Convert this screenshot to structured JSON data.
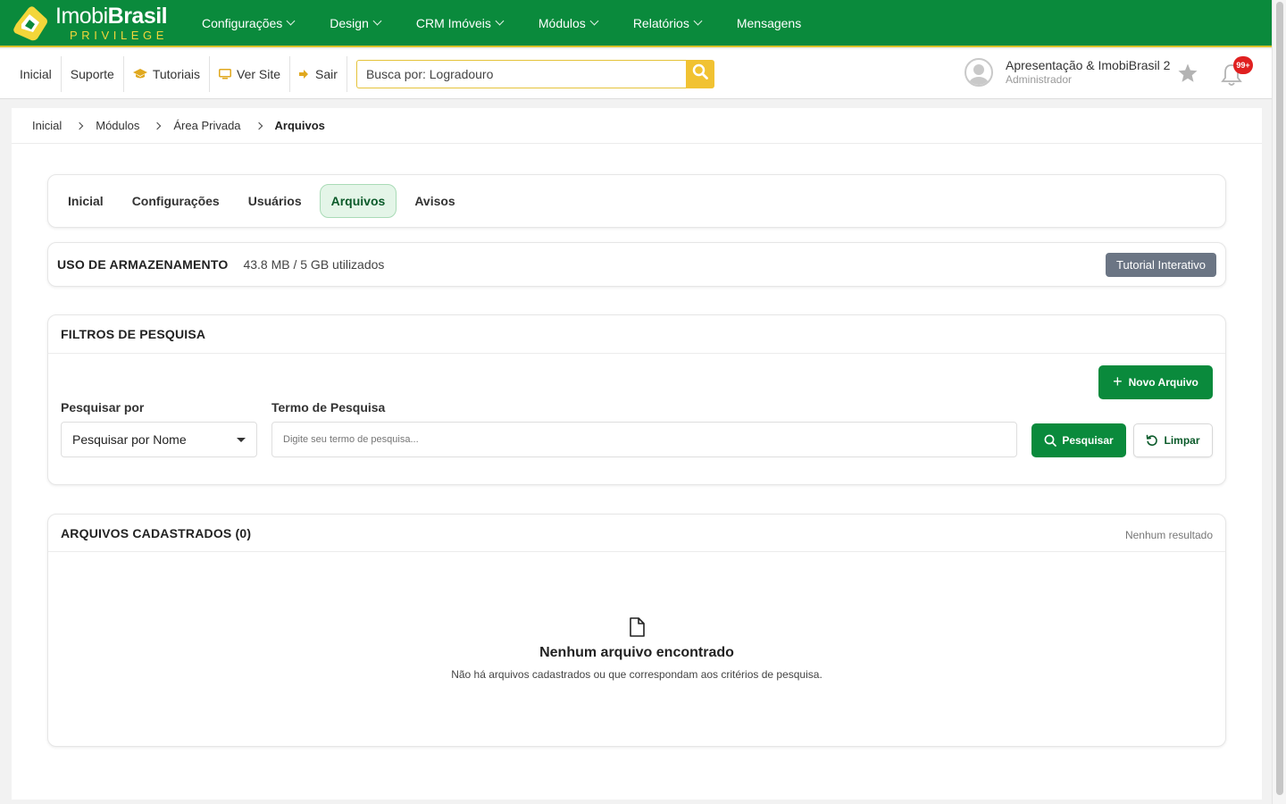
{
  "brand": {
    "name_light": "Imobi",
    "name_bold": "Brasil",
    "tagline": "PRIVILEGE",
    "colors": {
      "primary_green": "#0a8a3c",
      "accent_yellow": "#f1c232",
      "badge_red": "#e02020"
    }
  },
  "main_nav": [
    {
      "label": "Configurações",
      "has_dropdown": true
    },
    {
      "label": "Design",
      "has_dropdown": true
    },
    {
      "label": "CRM Imóveis",
      "has_dropdown": true
    },
    {
      "label": "Módulos",
      "has_dropdown": true
    },
    {
      "label": "Relatórios",
      "has_dropdown": true
    },
    {
      "label": "Mensagens",
      "has_dropdown": false
    }
  ],
  "toolbar": {
    "links": [
      {
        "label": "Inicial",
        "icon": ""
      },
      {
        "label": "Suporte",
        "icon": ""
      },
      {
        "label": "Tutoriais",
        "icon": "graduation-cap-icon"
      },
      {
        "label": "Ver Site",
        "icon": "monitor-icon"
      },
      {
        "label": "Sair",
        "icon": "sign-out-icon"
      }
    ],
    "search_value": "Busca por: Logradouro"
  },
  "user": {
    "name": "Apresentação & ImobiBrasil 2",
    "role": "Administrador",
    "notification_badge": "99+"
  },
  "breadcrumb": [
    "Inicial",
    "Módulos",
    "Área Privada",
    "Arquivos"
  ],
  "tabs": [
    {
      "label": "Inicial",
      "active": false
    },
    {
      "label": "Configurações",
      "active": false
    },
    {
      "label": "Usuários",
      "active": false
    },
    {
      "label": "Arquivos",
      "active": true
    },
    {
      "label": "Avisos",
      "active": false
    }
  ],
  "storage": {
    "label": "USO DE ARMAZENAMENTO",
    "value": "43.8 MB / 5 GB utilizados",
    "tutorial_button": "Tutorial Interativo"
  },
  "filters": {
    "title": "FILTROS DE PESQUISA",
    "new_button": "Novo Arquivo",
    "search_by_label": "Pesquisar por",
    "search_by_selected": "Pesquisar por Nome",
    "term_label": "Termo de Pesquisa",
    "term_placeholder": "Digite seu termo de pesquisa...",
    "search_button": "Pesquisar",
    "clear_button": "Limpar"
  },
  "results": {
    "title": "ARQUIVOS CADASTRADOS (0)",
    "count_text": "Nenhum resultado",
    "empty_title": "Nenhum arquivo encontrado",
    "empty_description": "Não há arquivos cadastrados ou que correspondam aos critérios de pesquisa."
  }
}
